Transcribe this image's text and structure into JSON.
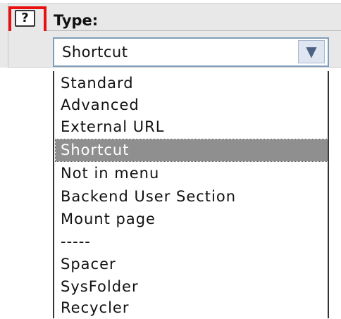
{
  "field": {
    "label": "Type:",
    "help_icon": "?",
    "selected_value": "Shortcut",
    "dropdown_arrow": "▼"
  },
  "options": [
    {
      "label": "Standard",
      "selected": false
    },
    {
      "label": "Advanced",
      "selected": false
    },
    {
      "label": "External URL",
      "selected": false
    },
    {
      "label": "Shortcut",
      "selected": true
    },
    {
      "label": "Not in menu",
      "selected": false
    },
    {
      "label": "Backend User Section",
      "selected": false
    },
    {
      "label": "Mount page",
      "selected": false
    },
    {
      "label": "-----",
      "selected": false
    },
    {
      "label": "Spacer",
      "selected": false
    },
    {
      "label": "SysFolder",
      "selected": false
    },
    {
      "label": "Recycler",
      "selected": false
    }
  ],
  "colors": {
    "highlight_box": "#e81010",
    "selected_option_bg": "#8f8f8f",
    "panel_bg": "#e8e8e8"
  }
}
